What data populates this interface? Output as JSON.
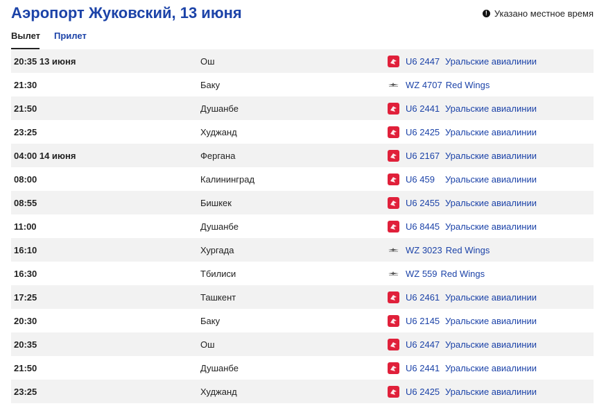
{
  "header": {
    "title": "Аэропорт Жуковский, 13 июня",
    "local_time_note": "Указано местное время",
    "info_icon": "!"
  },
  "tabs": [
    {
      "label": "Вылет",
      "active": true
    },
    {
      "label": "Прилет",
      "active": false
    }
  ],
  "colors": {
    "accent": "#1c43a8",
    "ural_logo": "#e0203a",
    "row_stripe": "#f2f2f2"
  },
  "flights": [
    {
      "time": "20:35 13 июня",
      "city": "Ош",
      "flight": "U6 2447",
      "airline": "Уральские авиалинии",
      "logo": "ural-airlines-logo"
    },
    {
      "time": "21:30",
      "city": "Баку",
      "flight": "WZ 4707",
      "airline": "Red Wings",
      "logo": "red-wings-logo"
    },
    {
      "time": "21:50",
      "city": "Душанбе",
      "flight": "U6 2441",
      "airline": "Уральские авиалинии",
      "logo": "ural-airlines-logo"
    },
    {
      "time": "23:25",
      "city": "Худжанд",
      "flight": "U6 2425",
      "airline": "Уральские авиалинии",
      "logo": "ural-airlines-logo"
    },
    {
      "time": "04:00 14 июня",
      "city": "Фергана",
      "flight": "U6 2167",
      "airline": "Уральские авиалинии",
      "logo": "ural-airlines-logo"
    },
    {
      "time": "08:00",
      "city": "Калининград",
      "flight": "U6 459",
      "airline": "Уральские авиалинии",
      "logo": "ural-airlines-logo"
    },
    {
      "time": "08:55",
      "city": "Бишкек",
      "flight": "U6 2455",
      "airline": "Уральские авиалинии",
      "logo": "ural-airlines-logo"
    },
    {
      "time": "11:00",
      "city": "Душанбе",
      "flight": "U6 8445",
      "airline": "Уральские авиалинии",
      "logo": "ural-airlines-logo"
    },
    {
      "time": "16:10",
      "city": "Хургада",
      "flight": "WZ 3023",
      "airline": "Red Wings",
      "logo": "red-wings-logo"
    },
    {
      "time": "16:30",
      "city": "Тбилиси",
      "flight": "WZ 559",
      "airline": "Red Wings",
      "logo": "red-wings-logo"
    },
    {
      "time": "17:25",
      "city": "Ташкент",
      "flight": "U6 2461",
      "airline": "Уральские авиалинии",
      "logo": "ural-airlines-logo"
    },
    {
      "time": "20:30",
      "city": "Баку",
      "flight": "U6 2145",
      "airline": "Уральские авиалинии",
      "logo": "ural-airlines-logo"
    },
    {
      "time": "20:35",
      "city": "Ош",
      "flight": "U6 2447",
      "airline": "Уральские авиалинии",
      "logo": "ural-airlines-logo"
    },
    {
      "time": "21:50",
      "city": "Душанбе",
      "flight": "U6 2441",
      "airline": "Уральские авиалинии",
      "logo": "ural-airlines-logo"
    },
    {
      "time": "23:25",
      "city": "Худжанд",
      "flight": "U6 2425",
      "airline": "Уральские авиалинии",
      "logo": "ural-airlines-logo"
    }
  ]
}
